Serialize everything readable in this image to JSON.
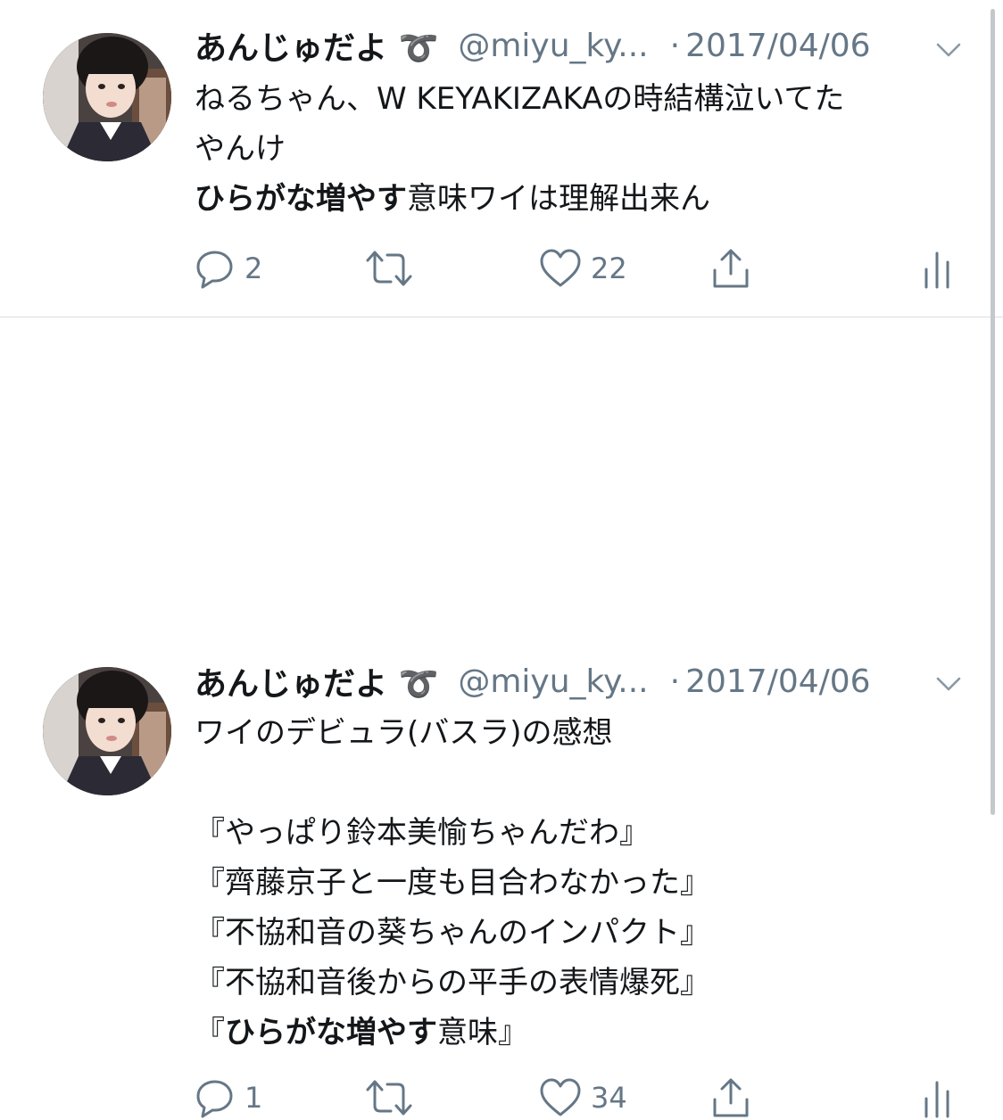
{
  "tweets": [
    {
      "name": "あんじゅだよ ➰",
      "handle": "@miyu_ky...",
      "separator": "·",
      "date": "2017/04/06",
      "lines": [
        {
          "parts": [
            {
              "text": "ねるちゃん、W KEYAKIZAKAの時結構泣いてた",
              "bold": false
            }
          ]
        },
        {
          "parts": [
            {
              "text": "やんけ",
              "bold": false
            }
          ]
        },
        {
          "parts": [
            {
              "text": "ひらがな増やす",
              "bold": true
            },
            {
              "text": "意味ワイは理解出来ん",
              "bold": false
            }
          ]
        }
      ],
      "reply_count": "2",
      "retweet_count": "",
      "like_count": "22"
    },
    {
      "name": "あんじゅだよ ➰",
      "handle": "@miyu_ky...",
      "separator": "·",
      "date": "2017/04/06",
      "lines": [
        {
          "parts": [
            {
              "text": "ワイのデビュラ(バスラ)の感想",
              "bold": false
            }
          ]
        },
        {
          "parts": []
        },
        {
          "parts": [
            {
              "text": "『やっぱり鈴本美愉ちゃんだわ』",
              "bold": false
            }
          ]
        },
        {
          "parts": [
            {
              "text": "『齊藤京子と一度も目合わなかった』",
              "bold": false
            }
          ]
        },
        {
          "parts": [
            {
              "text": "『不協和音の葵ちゃんのインパクト』",
              "bold": false
            }
          ]
        },
        {
          "parts": [
            {
              "text": "『不協和音後からの平手の表情爆死』",
              "bold": false
            }
          ]
        },
        {
          "parts": [
            {
              "text": "『",
              "bold": false
            },
            {
              "text": "ひらがな増やす",
              "bold": true
            },
            {
              "text": "意味』",
              "bold": false
            }
          ]
        }
      ],
      "reply_count": "1",
      "retweet_count": "",
      "like_count": "34"
    }
  ],
  "icons": {
    "reply": "reply-icon",
    "retweet": "retweet-icon",
    "like": "heart-icon",
    "share": "share-icon",
    "analytics": "analytics-icon",
    "more": "chevron-down-icon"
  },
  "colors": {
    "text": "#14171a",
    "secondary": "#657786",
    "divider": "#d9dee2"
  }
}
